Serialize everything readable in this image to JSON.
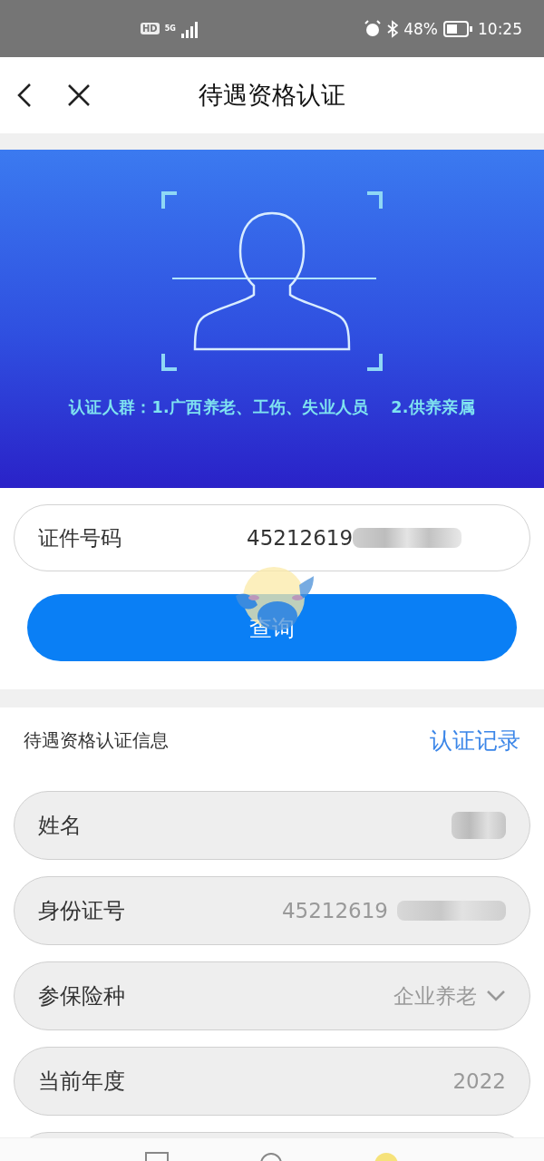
{
  "status_bar": {
    "battery": "48%",
    "time": "10:25",
    "network": "5G",
    "hd": "HD"
  },
  "header": {
    "title": "待遇资格认证"
  },
  "banner": {
    "caption": "认证人群：1.广西养老、工伤、失业人员　 2.供养亲属"
  },
  "query": {
    "label": "证件号码",
    "value": "45212619",
    "blurred": true,
    "button": "查询"
  },
  "info": {
    "title": "待遇资格认证信息",
    "link": "认证记录",
    "rows": [
      {
        "kind": "masked",
        "label": "姓名"
      },
      {
        "kind": "text",
        "label": "身份证号",
        "value": "45212619",
        "blurred": true
      },
      {
        "kind": "select",
        "label": "参保险种",
        "value": "企业养老"
      },
      {
        "kind": "text",
        "label": "当前年度",
        "value": "2022",
        "blurred": false
      }
    ]
  }
}
